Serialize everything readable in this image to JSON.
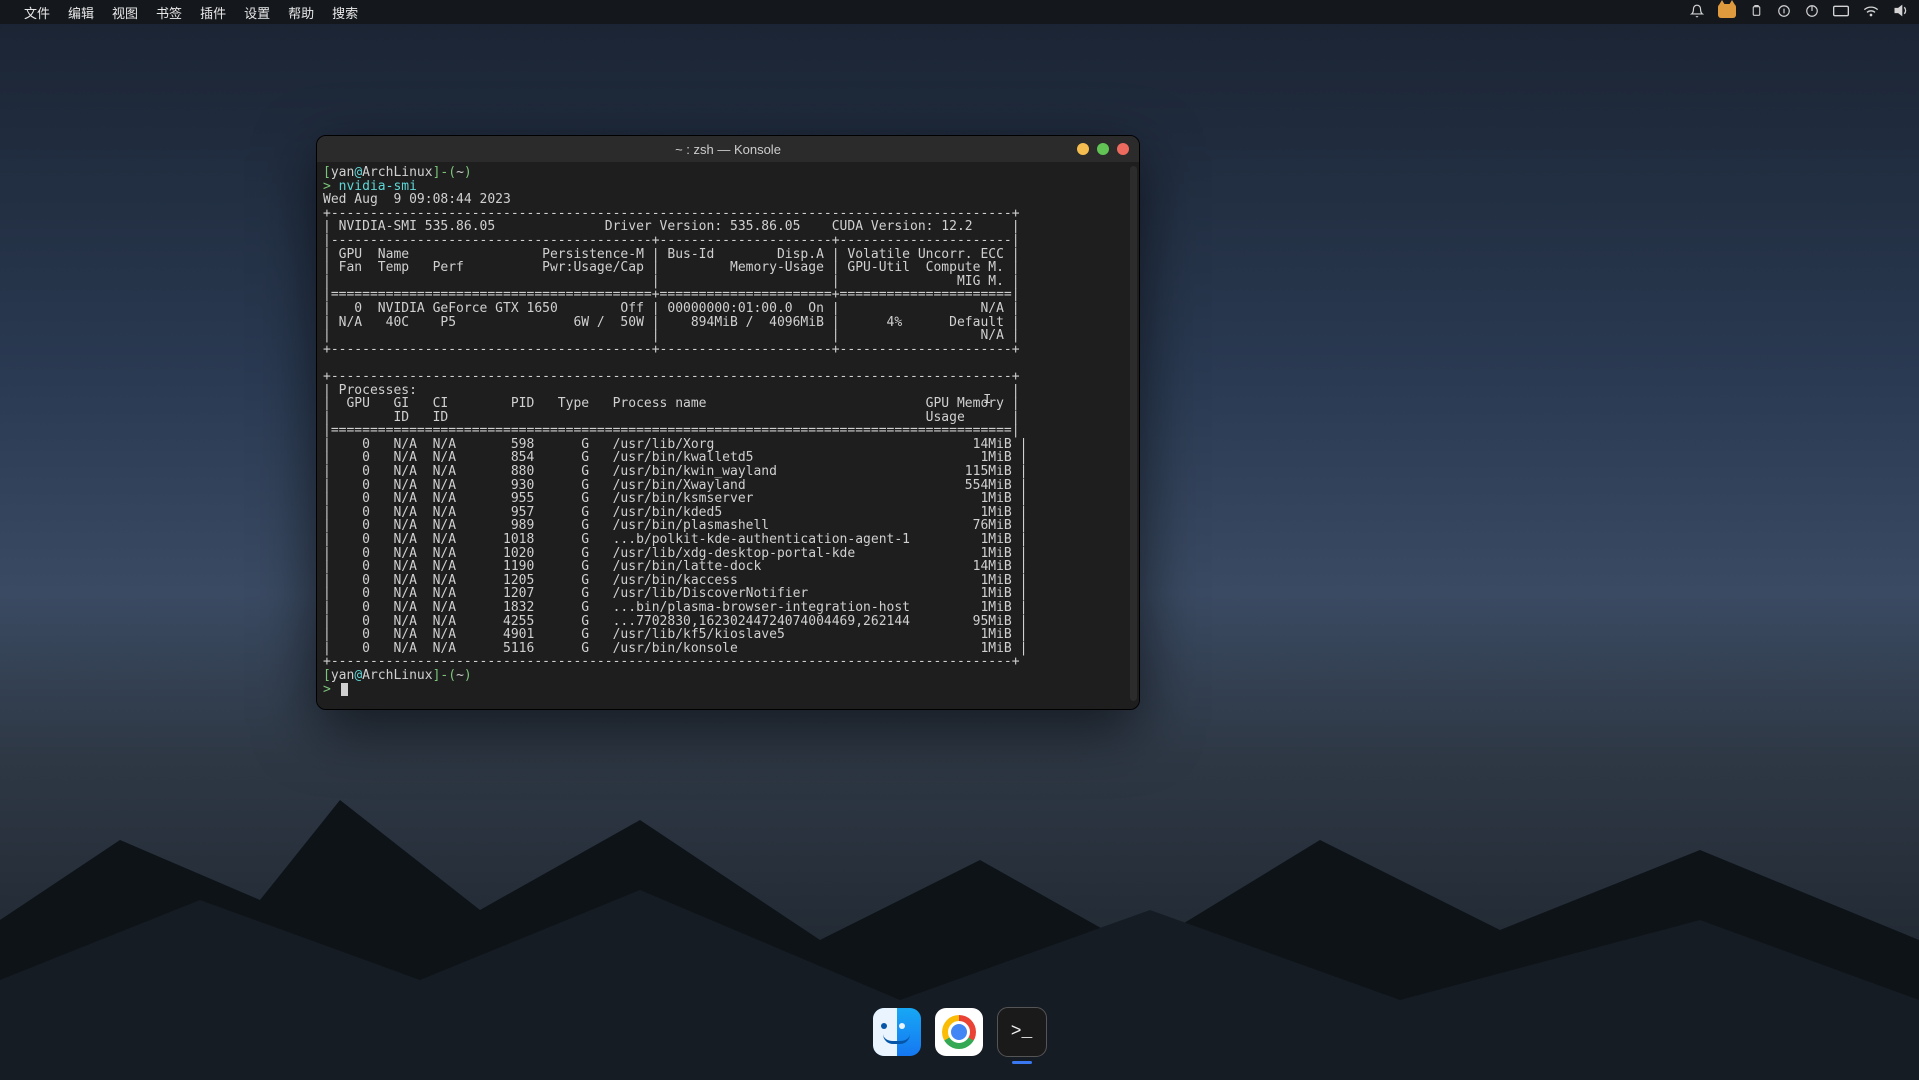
{
  "menubar": {
    "items": [
      "文件",
      "编辑",
      "视图",
      "书签",
      "插件",
      "设置",
      "帮助",
      "搜索"
    ]
  },
  "window": {
    "title": "~ : zsh — Konsole"
  },
  "prompt": {
    "user": "yan",
    "at": "@",
    "host": "ArchLinux",
    "sep_open": "[",
    "sep_close": "]-",
    "path_open": "(",
    "path": "~",
    "path_close": ")",
    "arrow": ">",
    "command": "nvidia-smi"
  },
  "smi": {
    "timestamp": "Wed Aug  9 09:08:44 2023",
    "version_line": "| NVIDIA-SMI 535.86.05              Driver Version: 535.86.05    CUDA Version: 12.2     |",
    "header1": "| GPU  Name                 Persistence-M | Bus-Id        Disp.A | Volatile Uncorr. ECC |",
    "header2": "| Fan  Temp   Perf          Pwr:Usage/Cap |         Memory-Usage | GPU-Util  Compute M. |",
    "header3": "|                                         |                      |               MIG M. |",
    "gpu1": "|   0  NVIDIA GeForce GTX 1650        Off | 00000000:01:00.0  On |                  N/A |",
    "gpu2": "| N/A   40C    P5               6W /  50W |    894MiB /  4096MiB |      4%      Default |",
    "gpu3": "|                                         |                      |                  N/A |",
    "proc_title": "| Processes:                                                                            |",
    "proc_h1": "|  GPU   GI   CI        PID   Type   Process name                            GPU Memory |",
    "proc_h2": "|        ID   ID                                                             Usage      |",
    "rows": [
      "|    0   N/A  N/A       598      G   /usr/lib/Xorg                                 14MiB |",
      "|    0   N/A  N/A       854      G   /usr/bin/kwalletd5                             1MiB |",
      "|    0   N/A  N/A       880      G   /usr/bin/kwin_wayland                        115MiB |",
      "|    0   N/A  N/A       930      G   /usr/bin/Xwayland                            554MiB |",
      "|    0   N/A  N/A       955      G   /usr/bin/ksmserver                             1MiB |",
      "|    0   N/A  N/A       957      G   /usr/bin/kded5                                 1MiB |",
      "|    0   N/A  N/A       989      G   /usr/bin/plasmashell                          76MiB |",
      "|    0   N/A  N/A      1018      G   ...b/polkit-kde-authentication-agent-1         1MiB |",
      "|    0   N/A  N/A      1020      G   /usr/lib/xdg-desktop-portal-kde                1MiB |",
      "|    0   N/A  N/A      1190      G   /usr/bin/latte-dock                           14MiB |",
      "|    0   N/A  N/A      1205      G   /usr/bin/kaccess                               1MiB |",
      "|    0   N/A  N/A      1207      G   /usr/lib/DiscoverNotifier                      1MiB |",
      "|    0   N/A  N/A      1832      G   ...bin/plasma-browser-integration-host         1MiB |",
      "|    0   N/A  N/A      4255      G   ...7702830,16230244724074004469,262144        95MiB |",
      "|    0   N/A  N/A      4901      G   /usr/lib/kf5/kioslave5                         1MiB |",
      "|    0   N/A  N/A      5116      G   /usr/bin/konsole                               1MiB |"
    ],
    "hr_top": "+---------------------------------------------------------------------------------------+",
    "hr_mid": "|-----------------------------------------+----------------------+----------------------|",
    "hr_eq": "|=========================================+======================+======================|",
    "hr_bot": "+-----------------------------------------+----------------------+----------------------+",
    "hr_proc": "+---------------------------------------------------------------------------------------+",
    "hr_proc_eq": "|=======================================================================================|"
  },
  "dock": {
    "apps": [
      "Finder",
      "Chrome",
      "Konsole"
    ],
    "active_index": 2
  }
}
